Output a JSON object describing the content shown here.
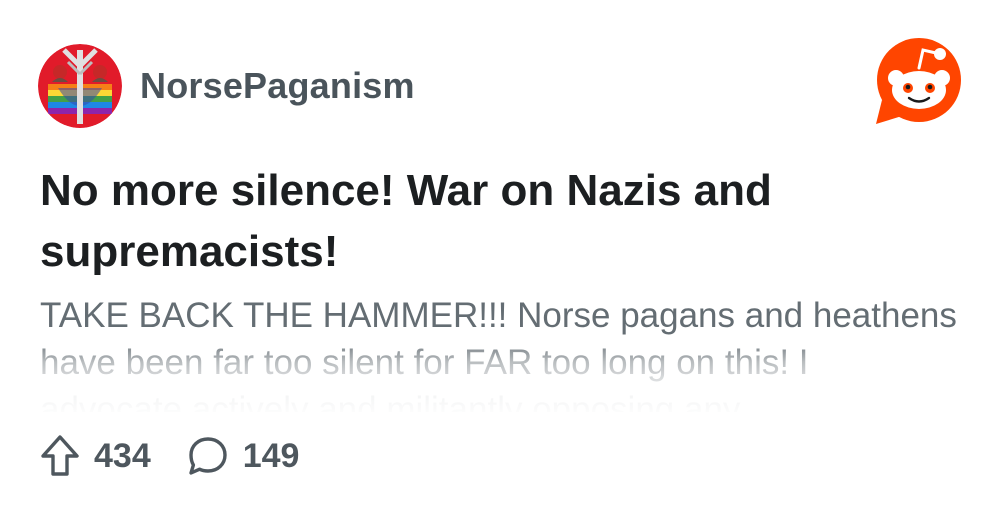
{
  "post": {
    "community": "NorsePaganism",
    "title": "No more silence! War on Nazis and supremacists!",
    "body": "TAKE BACK THE HAMMER!!! Norse pagans and heathens have been far too silent for FAR too long on this! I advocate actively and militantly opposing any"
  },
  "stats": {
    "upvotes": "434",
    "comments": "149"
  },
  "icons": {
    "avatar": "community-avatar-icon",
    "logo": "reddit-logo-icon",
    "upvote": "upvote-arrow-icon",
    "comment": "comment-bubble-icon"
  },
  "colors": {
    "reddit_orange": "#ff4500",
    "title_text": "#1c1f21",
    "body_text": "#646d73",
    "meta_text": "#4a545b"
  }
}
